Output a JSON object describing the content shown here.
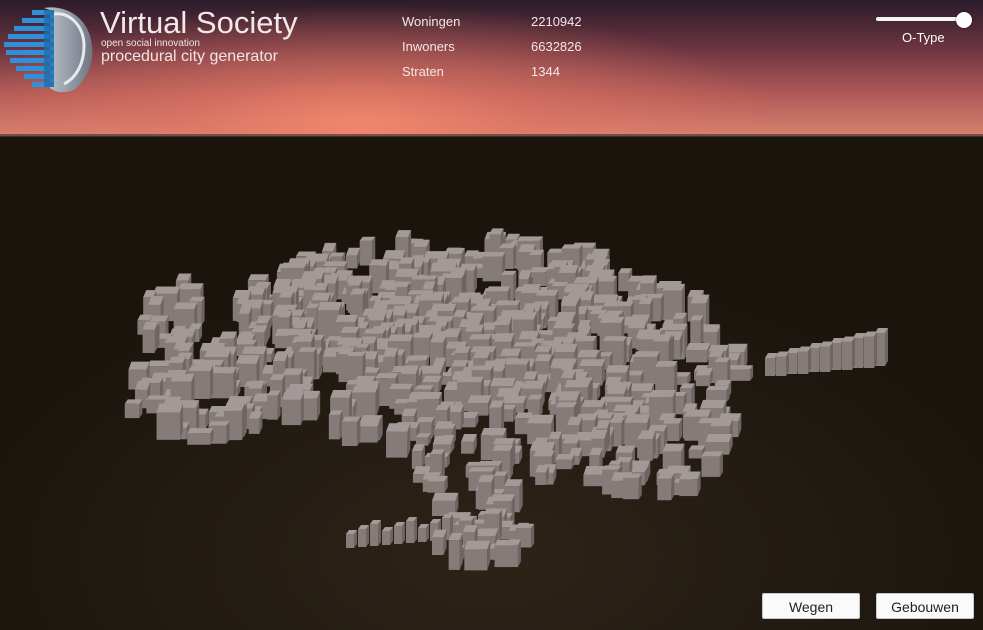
{
  "app": {
    "title": "Virtual Society",
    "tagline_small": "open social innovation",
    "tagline": "procedural city generator"
  },
  "stats": [
    {
      "label": "Woningen",
      "value": "2210942"
    },
    {
      "label": "Inwoners",
      "value": "6632826"
    },
    {
      "label": "Straten",
      "value": "1344"
    }
  ],
  "slider": {
    "label": "O-Type",
    "value": 1.0
  },
  "buttons": {
    "roads": "Wegen",
    "buildings": "Gebouwen"
  },
  "colors": {
    "sky_glow": "#e8866e",
    "ground": "#221b12",
    "building": "#8f8583",
    "button_bg": "#fafafa"
  }
}
